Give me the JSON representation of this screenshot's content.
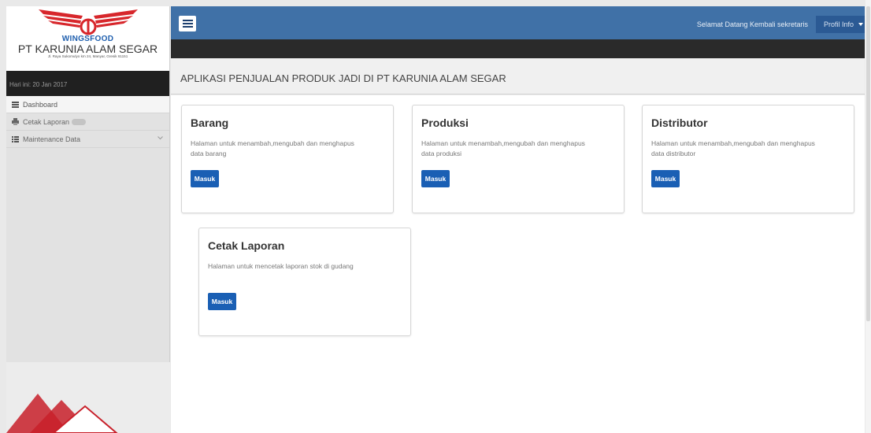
{
  "brand": {
    "logo_name": "WINGSFOOD",
    "company": "PT KARUNIA ALAM SEGAR",
    "address": "Jl. Raya Sukomulyo km 24, Manyar, Gresik 61151"
  },
  "date_label": "Hari ini: 20 Jan 2017",
  "sidebar": {
    "items": [
      {
        "label": "Dashboard",
        "icon": "dashboard-icon"
      },
      {
        "label": "Cetak Laporan",
        "icon": "print-icon"
      },
      {
        "label": "Maintenance Data",
        "icon": "list-icon"
      }
    ]
  },
  "topbar": {
    "welcome": "Selamat Datang Kembali sekretaris",
    "profile_label": "Profil Info"
  },
  "page_title": "APLIKASI PENJUALAN PRODUK JADI DI PT KARUNIA ALAM SEGAR",
  "cards": [
    {
      "title": "Barang",
      "description": "Halaman untuk menambah,mengubah dan menghapus data barang",
      "button": "Masuk"
    },
    {
      "title": "Produksi",
      "description": "Halaman untuk menambah,mengubah dan menghapus data produksi",
      "button": "Masuk"
    },
    {
      "title": "Distributor",
      "description": "Halaman untuk menambah,mengubah dan menghapus data distributor",
      "button": "Masuk"
    },
    {
      "title": "Cetak Laporan",
      "description": "Halaman untuk mencetak laporan stok di gudang",
      "button": "Masuk"
    }
  ],
  "colors": {
    "topbar": "#4071a7",
    "button": "#1a5fb4",
    "logo_red": "#d7262b",
    "watermark_red": "#c8202a"
  }
}
